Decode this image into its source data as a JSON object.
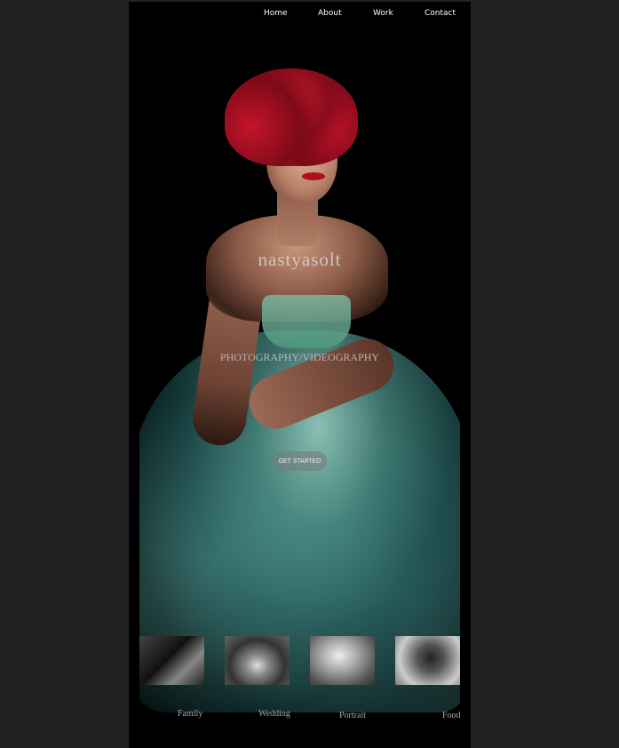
{
  "nav": {
    "home": "Home",
    "about": "About",
    "work": "Work",
    "contact": "Contact"
  },
  "hero": {
    "brand": "nastyasolt",
    "tagline": "PHOTOGRAPHY/VIDEOGRAPHY",
    "cta": "GET STARTED"
  },
  "categories": [
    {
      "label": "Family"
    },
    {
      "label": "Wedding"
    },
    {
      "label": "Portrait"
    },
    {
      "label": "Food"
    }
  ],
  "colors": {
    "background": "#222224",
    "page": "#000000",
    "accent": "#b0101c",
    "dress": "#7fc4b4"
  }
}
